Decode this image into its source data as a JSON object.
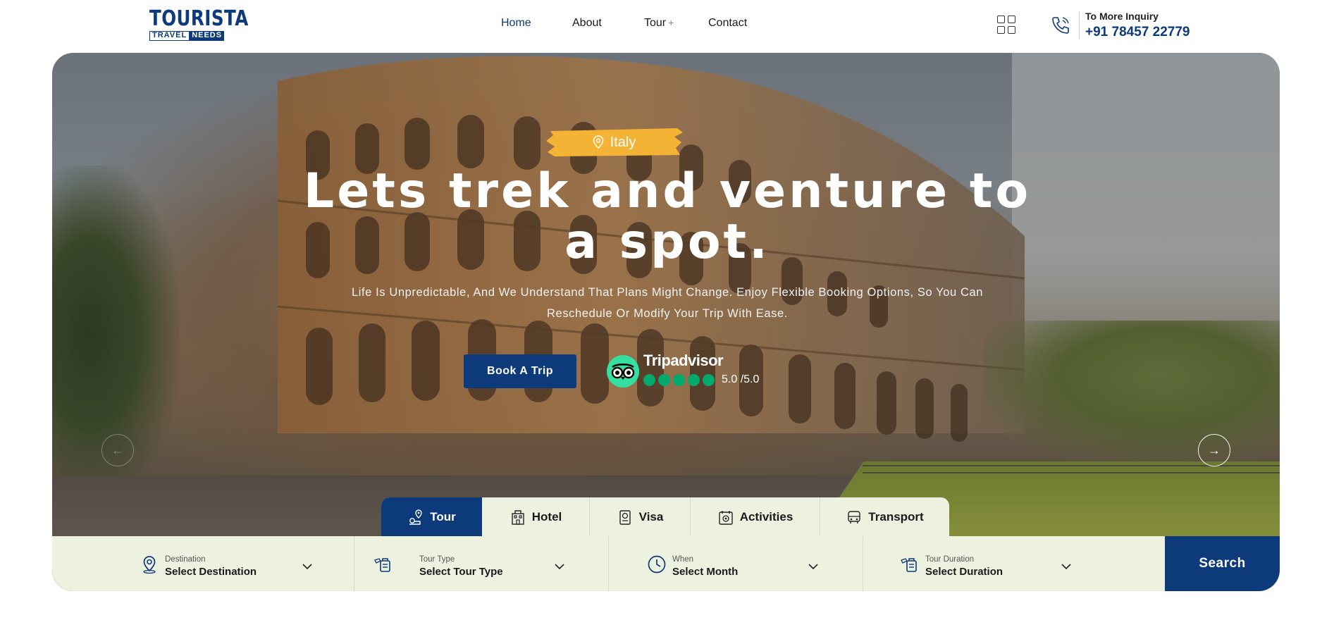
{
  "brand": {
    "logo_top": "TOURISTA",
    "logo_word1": "TRAVEL",
    "logo_word2": "NEEDS"
  },
  "nav": {
    "items": [
      {
        "label": "Home"
      },
      {
        "label": "About"
      },
      {
        "label": "Tour",
        "has_plus": true
      },
      {
        "label": "Contact"
      }
    ],
    "tour_plus": "+"
  },
  "inquiry": {
    "label": "To More Inquiry",
    "phone": "+91 78457 22779"
  },
  "hero": {
    "location": "Italy",
    "title_line1": "Lets trek and venture to",
    "title_line2": "a spot.",
    "subtitle_line1": "Life Is Unpredictable, And We Understand That Plans Might Change. Enjoy Flexible Booking Options, So You Can",
    "subtitle_line2": "Reschedule Or Modify Your Trip With Ease.",
    "cta": "Book A Trip",
    "rating_brand": "Tripadvisor",
    "rating_score": "5.0 /5.0",
    "rating_dots": 5,
    "next_arrow": "→",
    "prev_arrow": "←"
  },
  "tabs": [
    {
      "label": "Tour",
      "icon": "tour-icon",
      "active": true
    },
    {
      "label": "Hotel",
      "icon": "hotel-icon",
      "active": false
    },
    {
      "label": "Visa",
      "icon": "visa-icon",
      "active": false
    },
    {
      "label": "Activities",
      "icon": "activities-icon",
      "active": false
    },
    {
      "label": "Transport",
      "icon": "transport-icon",
      "active": false
    }
  ],
  "search": {
    "fields": [
      {
        "label": "Destination",
        "value": "Select Destination",
        "icon": "map-pin-icon"
      },
      {
        "label": "Tour Type",
        "value": "Select Tour Type",
        "icon": "tour-type-icon"
      },
      {
        "label": "When",
        "value": "Select Month",
        "icon": "clock-icon"
      },
      {
        "label": "Tour Duration",
        "value": "Select Duration",
        "icon": "duration-icon"
      }
    ],
    "button": "Search"
  },
  "colors": {
    "brand_blue": "#0d3a7a",
    "accent_yellow": "#f5b335",
    "panel_bg": "#edf1e0",
    "tripadvisor_green": "#00aa6c"
  }
}
